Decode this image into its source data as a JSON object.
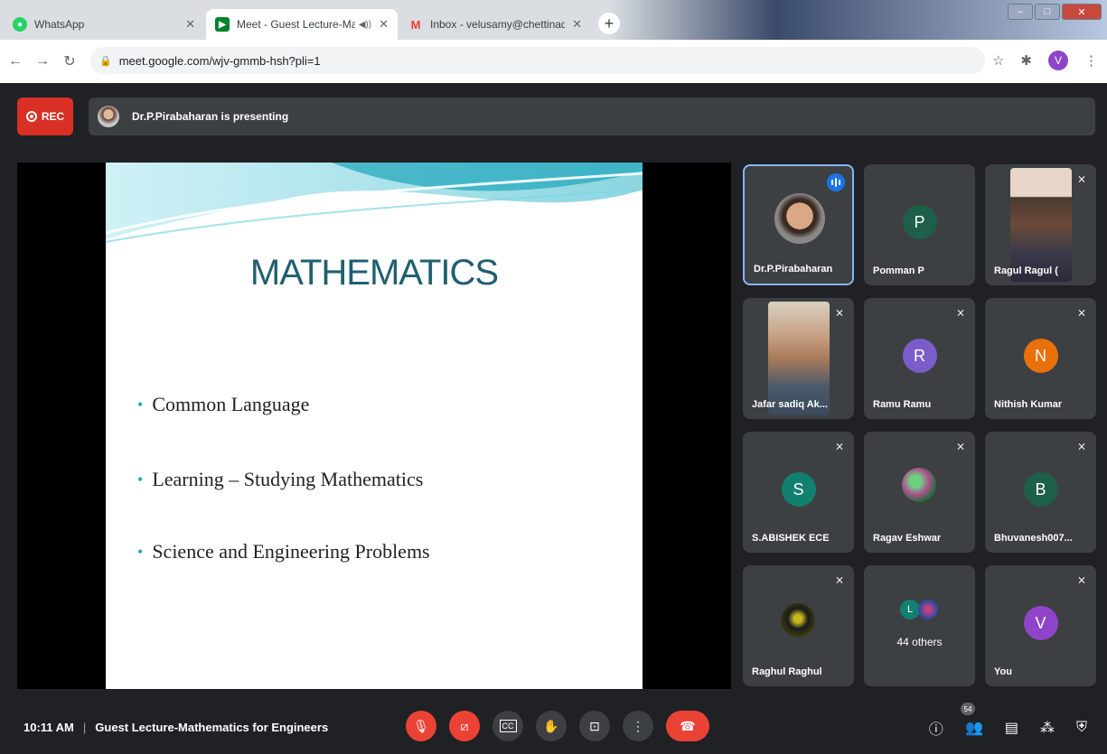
{
  "browser": {
    "tabs": [
      {
        "title": "WhatsApp",
        "favicon": "whatsapp-icon",
        "color": "#25d366",
        "close": "✕"
      },
      {
        "title": "Meet - Guest Lecture-Mathe",
        "favicon": "meet-icon",
        "color": "#00832d",
        "close": "✕",
        "active": true
      },
      {
        "title": "Inbox - velusamy@chettinadtech",
        "favicon": "gmail-icon",
        "color": "#ea4335",
        "close": "✕"
      }
    ],
    "new_tab": "+",
    "url": "meet.google.com/wjv-gmmb-hsh?pli=1",
    "profile_initial": "V"
  },
  "meet": {
    "rec_label": "REC",
    "presenting_text": "Dr.P.Pirabaharan is presenting",
    "slide": {
      "title": "MATHEMATICS",
      "bullets": [
        "Common Language",
        "Learning – Studying  Mathematics",
        "Science and Engineering Problems"
      ]
    },
    "participants": [
      {
        "name": "Dr.P.Pirabaharan",
        "type": "photo",
        "speaking": true
      },
      {
        "name": "Pomman P",
        "initial": "P",
        "color": "#1e5f4a"
      },
      {
        "name": "Ragul Ragul (",
        "type": "photo",
        "muted": true
      },
      {
        "name": "Jafar sadiq Ak...",
        "type": "photo",
        "muted": true
      },
      {
        "name": "Ramu Ramu",
        "initial": "R",
        "color": "#7b5cc8",
        "muted": true
      },
      {
        "name": "Nithish Kumar",
        "initial": "N",
        "color": "#e8710a",
        "muted": true
      },
      {
        "name": "S.ABISHEK ECE",
        "initial": "S",
        "color": "#12806e",
        "muted": true
      },
      {
        "name": "Ragav Eshwar",
        "type": "photo",
        "muted": true
      },
      {
        "name": "Bhuvanesh007...",
        "initial": "B",
        "color": "#1e5f4a",
        "muted": true
      },
      {
        "name": "Raghul Raghul",
        "type": "photo",
        "muted": true
      },
      {
        "name": "44 others",
        "type": "others"
      },
      {
        "name": "You",
        "initial": "V",
        "color": "#8e44c8",
        "muted": true
      }
    ],
    "bottom": {
      "time": "10:11 AM",
      "separator": "|",
      "meeting_title": "Guest Lecture-Mathematics for Engineers",
      "people_count": "54"
    }
  }
}
